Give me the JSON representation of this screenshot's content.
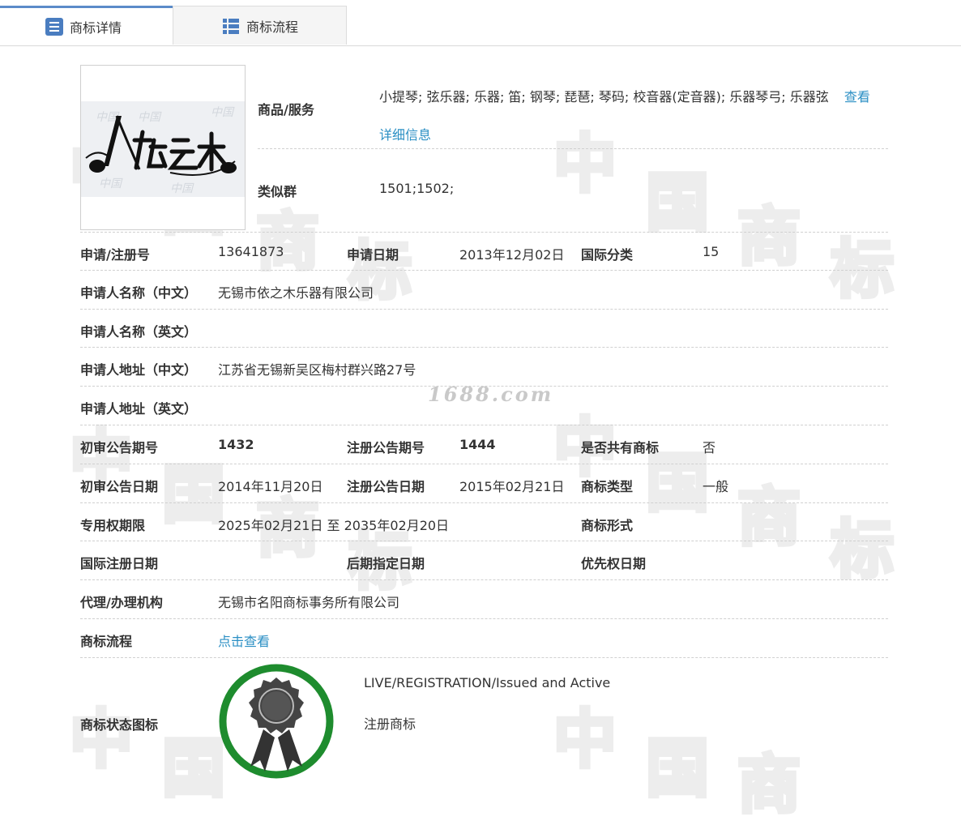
{
  "tabs": [
    {
      "label": "商标详情",
      "icon": "list-detail-icon",
      "active": true
    },
    {
      "label": "商标流程",
      "icon": "list-flow-icon",
      "active": false
    }
  ],
  "logo": {
    "alt": "依之木"
  },
  "goods_services": {
    "label": "商品/服务",
    "value": "小提琴; 弦乐器; 乐器; 笛; 钢琴; 琵琶; 琴码; 校音器(定音器); 乐器琴弓; 乐器弦",
    "link1": "查看",
    "link2": "详细信息"
  },
  "similar_group": {
    "label": "类似群",
    "value": "1501;1502;"
  },
  "fields": {
    "reg_no_label": "申请/注册号",
    "reg_no": "13641873",
    "apply_date_label": "申请日期",
    "apply_date": "2013年12月02日",
    "intl_class_label": "国际分类",
    "intl_class": "15",
    "applicant_cn_label": "申请人名称（中文）",
    "applicant_cn": "无锡市依之木乐器有限公司",
    "applicant_en_label": "申请人名称（英文）",
    "applicant_en": "",
    "address_cn_label": "申请人地址（中文）",
    "address_cn": "江苏省无锡新吴区梅村群兴路27号",
    "address_en_label": "申请人地址（英文）",
    "address_en": "",
    "prelim_no_label": "初审公告期号",
    "prelim_no": "1432",
    "reg_pub_no_label": "注册公告期号",
    "reg_pub_no": "1444",
    "shared_label": "是否共有商标",
    "shared": "否",
    "prelim_date_label": "初审公告日期",
    "prelim_date": "2014年11月20日",
    "reg_pub_date_label": "注册公告日期",
    "reg_pub_date": "2015年02月21日",
    "type_label": "商标类型",
    "type": "一般",
    "exclusive_label": "专用权期限",
    "exclusive": "2025年02月21日 至 2035年02月20日",
    "form_label": "商标形式",
    "form": "",
    "intl_reg_label": "国际注册日期",
    "intl_reg": "",
    "later_label": "后期指定日期",
    "later": "",
    "priority_label": "优先权日期",
    "priority": "",
    "agent_label": "代理/办理机构",
    "agent": "无锡市名阳商标事务所有限公司",
    "flow_label": "商标流程",
    "flow_link": "点击查看"
  },
  "status": {
    "label": "商标状态图标",
    "line1": "LIVE/REGISTRATION/Issued and Active",
    "line2": "注册商标",
    "icon": "award-ribbon-icon",
    "ring_color": "#1e8c2e"
  },
  "watermark": {
    "text": "1688.com",
    "chars": [
      "中",
      "国",
      "商",
      "标"
    ]
  },
  "colors": {
    "link": "#2b8fc4",
    "tab_accent": "#5b8bc9"
  }
}
